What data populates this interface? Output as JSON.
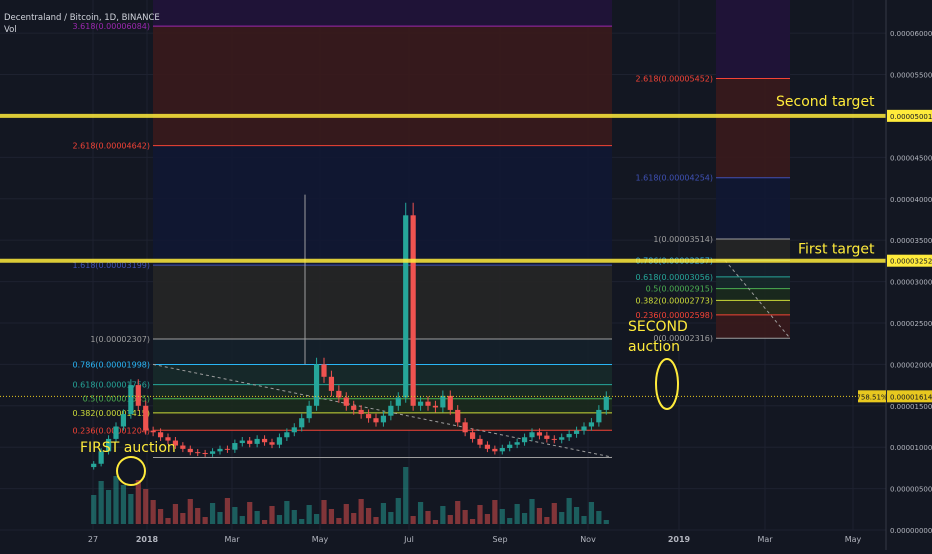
{
  "header": {
    "title": "Decentraland / Bitcoin, 1D, BINANCE",
    "vol_label": "Vol"
  },
  "colors": {
    "bg": "#131722",
    "grid": "#1e2230",
    "price_line": "#e8c81f",
    "candle_up": "#26a69a",
    "candle_down": "#ef5350",
    "yellow": "#ffeb3b",
    "fib_red": "#3a1a1c",
    "fib_blue": "#111733",
    "fib_purple": "#1f1337"
  },
  "chart_data": {
    "type": "candlestick",
    "symbol": "Decentraland / Bitcoin",
    "timeframe": "1D",
    "exchange": "BINANCE",
    "y_range": [
      0.0,
      6.4e-05
    ],
    "x_axis_ticks": [
      "27",
      "2018",
      "Mar",
      "May",
      "Jul",
      "Sep",
      "Nov",
      "2019",
      "Mar",
      "May"
    ],
    "y_axis_ticks": [
      "0.00006000",
      "0.00005500",
      "0.00005001",
      "0.00004500",
      "0.00004000",
      "0.00003500",
      "0.00003252",
      "0.00003000",
      "0.00002500",
      "0.00002000",
      "0.00001614",
      "0.00001500",
      "0.00001000",
      "0.00000500",
      "0.00000000"
    ],
    "current_price": {
      "label": "0.00001614",
      "value": 1.614e-05,
      "pct_label": "758.51%"
    },
    "fib_extension_1": {
      "levels": [
        {
          "label": "0.236(0.00001204)",
          "value": 1.204e-05,
          "color": "#f44336"
        },
        {
          "label": "0.382(0.00001415)",
          "value": 1.415e-05,
          "color": "#cddc39"
        },
        {
          "label": "0.5(0.00001585)",
          "value": 1.585e-05,
          "color": "#4caf50"
        },
        {
          "label": "0.618(0.00001756)",
          "value": 1.756e-05,
          "color": "#26a69a"
        },
        {
          "label": "0.786(0.00001998)",
          "value": 1.998e-05,
          "color": "#29b6f6"
        },
        {
          "label": "1(0.00002307)",
          "value": 2.307e-05,
          "color": "#9e9e9e"
        },
        {
          "label": "1.618(0.00003199)",
          "value": 3.199e-05,
          "color": "#3f51b5"
        },
        {
          "label": "2.618(0.00004642)",
          "value": 4.642e-05,
          "color": "#f44336"
        },
        {
          "label": "3.618(0.00006084)",
          "value": 6.084e-05,
          "color": "#9c27b0"
        }
      ]
    },
    "fib_extension_2": {
      "levels": [
        {
          "label": "0(0.00002316)",
          "value": 2.316e-05,
          "color": "#9e9e9e"
        },
        {
          "label": "0.236(0.00002598)",
          "value": 2.598e-05,
          "color": "#f44336"
        },
        {
          "label": "0.382(0.00002773)",
          "value": 2.773e-05,
          "color": "#cddc39"
        },
        {
          "label": "0.5(0.00002915)",
          "value": 2.915e-05,
          "color": "#4caf50"
        },
        {
          "label": "0.618(0.00003056)",
          "value": 3.056e-05,
          "color": "#26a69a"
        },
        {
          "label": "0.786(0.00003257)",
          "value": 3.257e-05,
          "color": "#29b6f6"
        },
        {
          "label": "1(0.00003514)",
          "value": 3.514e-05,
          "color": "#9e9e9e"
        },
        {
          "label": "1.618(0.00004254)",
          "value": 4.254e-05,
          "color": "#3f51b5"
        },
        {
          "label": "2.618(0.00005452)",
          "value": 5.452e-05,
          "color": "#f44336"
        }
      ]
    },
    "horizontal_lines": [
      {
        "label": "Second target",
        "value": 5.001e-05
      },
      {
        "label": "First target",
        "value": 3.252e-05
      }
    ],
    "annotations": [
      {
        "text": "FIRST auction"
      },
      {
        "text": "SECOND auction"
      }
    ],
    "price_series": [
      8e-06,
      9.5e-06,
      1.1e-05,
      1.25e-05,
      1.4e-05,
      1.75e-05,
      1.5e-05,
      1.2e-05,
      1.18e-05,
      1.12e-05,
      1.08e-05,
      1.02e-05,
      9.8e-06,
      9.4e-06,
      9.3e-06,
      9.2e-06,
      9.5e-06,
      9.8e-06,
      9.7e-06,
      1.05e-05,
      1.08e-05,
      1.04e-05,
      1.1e-05,
      1.06e-05,
      1.03e-05,
      1.12e-05,
      1.18e-05,
      1.24e-05,
      1.35e-05,
      1.5e-05,
      2e-05,
      1.85e-05,
      1.68e-05,
      1.6e-05,
      1.5e-05,
      1.45e-05,
      1.4e-05,
      1.35e-05,
      1.3e-05,
      1.38e-05,
      1.5e-05,
      1.6e-05,
      3.8e-05,
      1.5e-05,
      1.55e-05,
      1.5e-05,
      1.48e-05,
      1.62e-05,
      1.45e-05,
      1.3e-05,
      1.18e-05,
      1.1e-05,
      1.03e-05,
      9.8e-06,
      9.5e-06,
      9.9e-06,
      1.03e-05,
      1.06e-05,
      1.12e-05,
      1.18e-05,
      1.14e-05,
      1.1e-05,
      1.09e-05,
      1.12e-05,
      1.16e-05,
      1.2e-05,
      1.25e-05,
      1.3e-05,
      1.45e-05,
      1.61e-05
    ]
  }
}
